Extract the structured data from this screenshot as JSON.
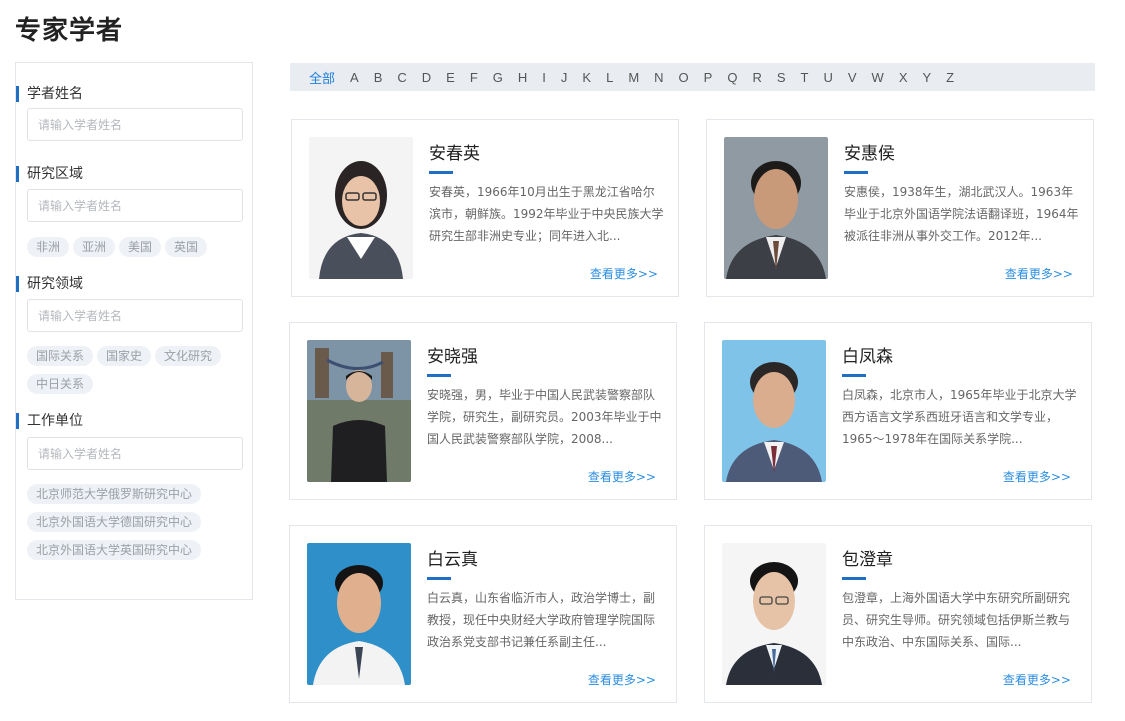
{
  "page": {
    "title": "专家学者"
  },
  "sidebar": {
    "sections": [
      {
        "heading": "学者姓名",
        "placeholder": "请输入学者姓名",
        "tags": []
      },
      {
        "heading": "研究区域",
        "placeholder": "请输入学者姓名",
        "tags": [
          "非洲",
          "亚洲",
          "美国",
          "英国"
        ]
      },
      {
        "heading": "研究领域",
        "placeholder": "请输入学者姓名",
        "tags": [
          "国际关系",
          "国家史",
          "文化研究",
          "中日关系"
        ]
      },
      {
        "heading": "工作单位",
        "placeholder": "请输入学者姓名",
        "tags": [
          "北京师范大学俄罗斯研究中心",
          "北京外国语大学德国研究中心",
          "北京外国语大学英国研究中心"
        ]
      }
    ]
  },
  "alphabet": {
    "all_label": "全部",
    "letters": [
      "A",
      "B",
      "C",
      "D",
      "E",
      "F",
      "G",
      "H",
      "I",
      "J",
      "K",
      "L",
      "M",
      "N",
      "O",
      "P",
      "Q",
      "R",
      "S",
      "T",
      "U",
      "V",
      "W",
      "X",
      "Y",
      "Z"
    ]
  },
  "more_label": "查看更多>>",
  "scholars": [
    {
      "name": "安春英",
      "bio": "安春英，1966年10月出生于黑龙江省哈尔滨市，朝鲜族。1992年毕业于中央民族大学研究生部非洲史专业；同年进入北..."
    },
    {
      "name": "安惠侯",
      "bio": "安惠侯，1938年生，湖北武汉人。1963年毕业于北京外国语学院法语翻译班，1964年被派往非洲从事外交工作。2012年..."
    },
    {
      "name": "安晓强",
      "bio": "安晓强，男，毕业于中国人民武装警察部队学院，研究生，副研究员。2003年毕业于中国人民武装警察部队学院，2008..."
    },
    {
      "name": "白凤森",
      "bio": "白凤森，北京市人，1965年毕业于北京大学西方语言文学系西班牙语言和文学专业，1965～1978年在国际关系学院..."
    },
    {
      "name": "白云真",
      "bio": "白云真，山东省临沂市人，政治学博士，副教授，现任中央财经大学政府管理学院国际政治系党支部书记兼任系副主任..."
    },
    {
      "name": "包澄章",
      "bio": "包澄章，上海外国语大学中东研究所副研究员、研究生导师。研究领域包括伊斯兰教与中东政治、中东国际关系、国际..."
    }
  ],
  "colors": {
    "accent": "#1f6fc4",
    "link": "#2c8ee0",
    "active_letter": "#1f7fd8"
  }
}
